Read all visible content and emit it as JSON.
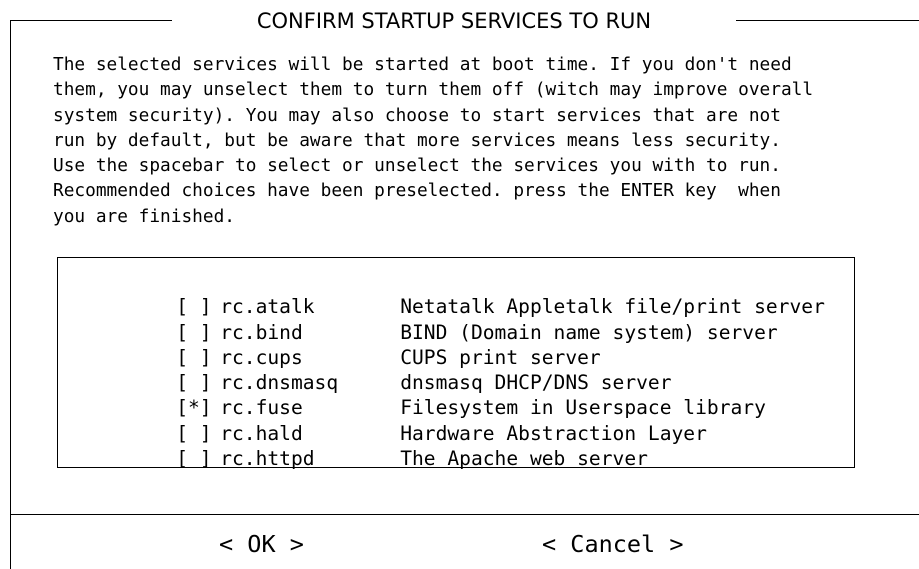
{
  "dialog": {
    "title": "CONFIRM STARTUP SERVICES TO RUN",
    "description": "The selected services will be started at boot time. If you don't need\nthem, you may unselect them to turn them off (witch may improve overall\nsystem security). You may also choose to start services that are not\nrun by default, but be aware that more services means less security.\nUse the spacebar to select or unselect the services you with to run.\nRecommended choices have been preselected. press the ENTER key  when\nyou are finished."
  },
  "services": [
    {
      "check": "[ ]",
      "name": "rc.atalk",
      "description": "Netatalk Appletalk file/print server"
    },
    {
      "check": "[ ]",
      "name": "rc.bind",
      "description": "BIND (Domain name system) server"
    },
    {
      "check": "[ ]",
      "name": "rc.cups",
      "description": "CUPS print server"
    },
    {
      "check": "[ ]",
      "name": "rc.dnsmasq",
      "description": "dnsmasq DHCP/DNS server"
    },
    {
      "check": "[*]",
      "name": "rc.fuse",
      "description": "Filesystem in Userspace library"
    },
    {
      "check": "[ ]",
      "name": "rc.hald",
      "description": "Hardware Abstraction Layer"
    },
    {
      "check": "[ ]",
      "name": "rc.httpd",
      "description": "The Apache web server"
    }
  ],
  "buttons": {
    "ok_label": "< OK >",
    "cancel_label": "< Cancel >"
  }
}
